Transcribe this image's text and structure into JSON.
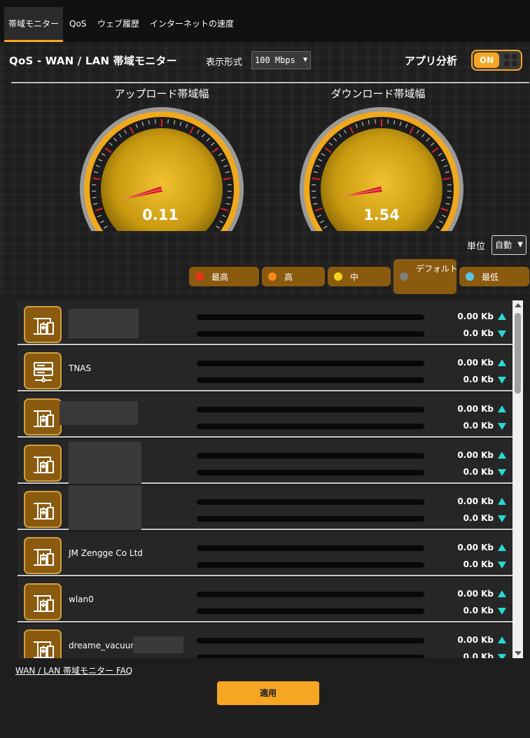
{
  "tabs": [
    {
      "label": "帯域モニター",
      "active": true
    },
    {
      "label": "QoS",
      "active": false
    },
    {
      "label": "ウェブ履歴",
      "active": false
    },
    {
      "label": "インターネットの速度",
      "active": false
    }
  ],
  "header": {
    "title": "QoS - WAN / LAN 帯域モニター",
    "display_label": "表示形式",
    "display_value": "100 Mbps",
    "app_analysis_label": "アプリ分析",
    "app_analysis_toggle": "ON"
  },
  "gauges": {
    "upload": {
      "title": "アップロード帯域幅",
      "value": "0.11",
      "scale_max": 100,
      "reading": 0.11
    },
    "download": {
      "title": "ダウンロード帯域幅",
      "value": "1.54",
      "scale_max": 100,
      "reading": 1.54
    }
  },
  "unit": {
    "label": "単位",
    "value": "自動"
  },
  "priorities": [
    {
      "label": "最高",
      "color": "#e8341c"
    },
    {
      "label": "高",
      "color": "#f5891e"
    },
    {
      "label": "中",
      "color": "#f2d21b"
    },
    {
      "label": "デフォルト",
      "color": "#808080"
    },
    {
      "label": "最低",
      "color": "#5ec5ea"
    }
  ],
  "devices": [
    {
      "name": "",
      "icon": "device-icon",
      "up": "0.00 Kb",
      "down": "0.0 Kb"
    },
    {
      "name": "TNAS",
      "icon": "server-icon",
      "up": "0.00 Kb",
      "down": "0.0 Kb"
    },
    {
      "name": "",
      "icon": "device-icon",
      "up": "0.00 Kb",
      "down": "0.0 Kb"
    },
    {
      "name": "",
      "icon": "device-icon",
      "up": "0.00 Kb",
      "down": "0.0 Kb"
    },
    {
      "name": "",
      "icon": "device-icon",
      "up": "0.00 Kb",
      "down": "0.0 Kb"
    },
    {
      "name": "JM Zengge Co Ltd",
      "icon": "device-icon",
      "up": "0.00 Kb",
      "down": "0.0 Kb"
    },
    {
      "name": "wlan0",
      "icon": "device-icon",
      "up": "0.00 Kb",
      "down": "0.0 Kb"
    },
    {
      "name": "dreame_vacuun",
      "icon": "device-icon",
      "up": "0.00 Kb",
      "down": "0.0 Kb"
    }
  ],
  "faq_link": "WAN / LAN 帯域モニター FAQ",
  "apply_label": "適用",
  "colors": {
    "accent": "#f5a623",
    "pill_bg": "#8a5a0f",
    "arrow": "#27d9d0"
  }
}
